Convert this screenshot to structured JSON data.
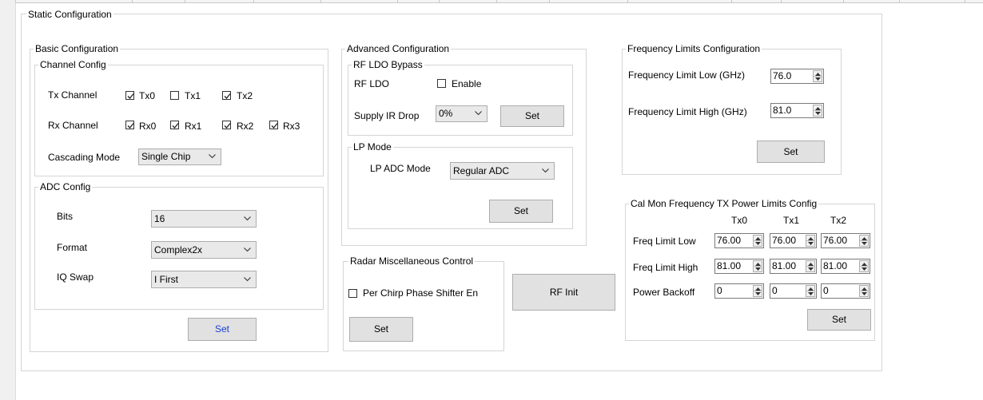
{
  "static_config": {
    "title": "Static Configuration"
  },
  "basic": {
    "title": "Basic Configuration",
    "channel": {
      "title": "Channel Config",
      "tx_label": "Tx Channel",
      "tx": [
        {
          "label": "Tx0",
          "checked": true
        },
        {
          "label": "Tx1",
          "checked": false
        },
        {
          "label": "Tx2",
          "checked": true
        }
      ],
      "rx_label": "Rx Channel",
      "rx": [
        {
          "label": "Rx0",
          "checked": true
        },
        {
          "label": "Rx1",
          "checked": true
        },
        {
          "label": "Rx2",
          "checked": true
        },
        {
          "label": "Rx3",
          "checked": true
        }
      ],
      "cascade_label": "Cascading Mode",
      "cascade_value": "Single Chip"
    },
    "adc": {
      "title": "ADC Config",
      "bits_label": "Bits",
      "bits_value": "16",
      "format_label": "Format",
      "format_value": "Complex2x",
      "iq_label": "IQ Swap",
      "iq_value": "I First"
    },
    "set_label": "Set"
  },
  "advanced": {
    "title": "Advanced Configuration",
    "rf_ldo_bypass": {
      "title": "RF LDO Bypass",
      "rf_ldo_label": "RF LDO",
      "enable_label": "Enable",
      "enable_checked": false,
      "supply_label": "Supply IR Drop",
      "supply_value": "0%",
      "set_label": "Set"
    },
    "lp_mode": {
      "title": "LP Mode",
      "adc_mode_label": "LP ADC Mode",
      "adc_mode_value": "Regular ADC",
      "set_label": "Set"
    }
  },
  "radar_misc": {
    "title": "Radar Miscellaneous Control",
    "phase_shifter_label": "Per Chirp Phase Shifter En",
    "phase_shifter_checked": false,
    "set_label": "Set"
  },
  "rf_init_label": "RF Init",
  "freq_limits": {
    "title": "Frequency Limits Configuration",
    "low_label": "Frequency Limit Low (GHz)",
    "low_value": "76.0",
    "high_label": "Frequency Limit High (GHz)",
    "high_value": "81.0",
    "set_label": "Set"
  },
  "calmon": {
    "title": "Cal Mon Frequency TX Power Limits Config",
    "cols": [
      "Tx0",
      "Tx1",
      "Tx2"
    ],
    "rows": [
      {
        "label": "Freq Limit Low",
        "values": [
          "76.00",
          "76.00",
          "76.00"
        ]
      },
      {
        "label": "Freq Limit High",
        "values": [
          "81.00",
          "81.00",
          "81.00"
        ]
      },
      {
        "label": "Power Backoff",
        "values": [
          "0",
          "0",
          "0"
        ]
      }
    ],
    "set_label": "Set"
  },
  "colors": {
    "set_text_blue": "#1a3fd6",
    "group_border": "#d5d5d5",
    "button_bg": "#e1e1e1"
  },
  "icons": {
    "checkbox_check": "check-icon",
    "dropdown": "chevron-down-icon",
    "spin": "spin-arrows-icon"
  }
}
